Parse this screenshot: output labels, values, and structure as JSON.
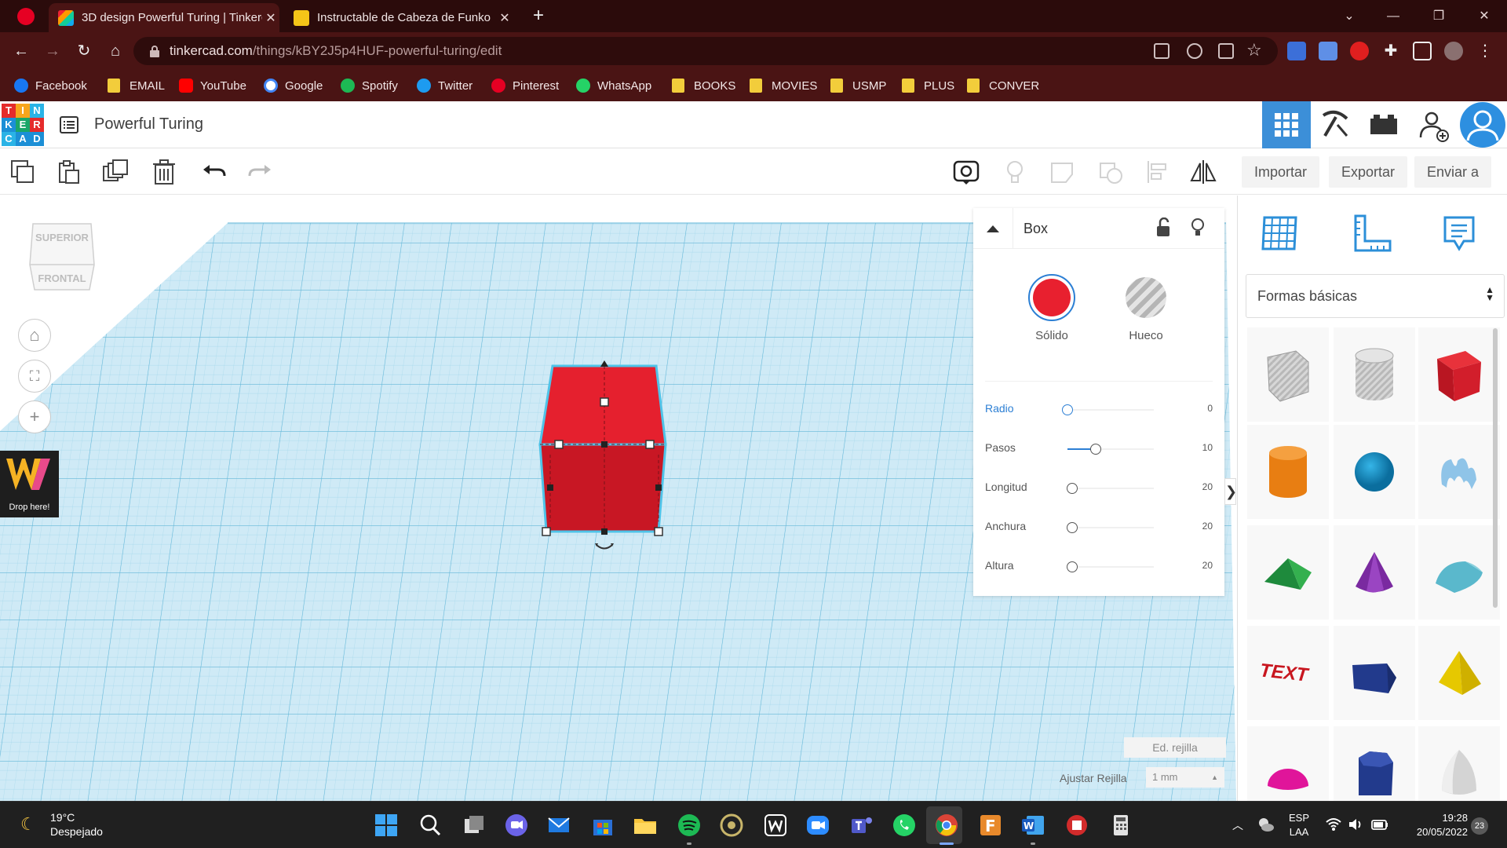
{
  "browser": {
    "tabs": [
      {
        "title": "3D design Powerful Turing | Tinkercad",
        "active": true
      },
      {
        "title": "Instructable de Cabeza de Funko",
        "active": false
      }
    ],
    "url_host": "tinkercad.com",
    "url_path": "/things/kBY2J5p4HUF-powerful-turing/edit",
    "bookmarks": [
      "Facebook",
      "EMAIL",
      "YouTube",
      "Google",
      "Spotify",
      "Twitter",
      "Pinterest",
      "WhatsApp",
      "BOOKS",
      "MOVIES",
      "USMP",
      "PLUS",
      "CONVER"
    ]
  },
  "app": {
    "logo_letters": [
      "T",
      "I",
      "N",
      "K",
      "E",
      "R",
      "C",
      "A",
      "D"
    ],
    "project_title": "Powerful Turing",
    "toolbar": {
      "import": "Importar",
      "export": "Exportar",
      "send_to": "Enviar a"
    }
  },
  "workplane": {
    "viewcube_top": "SUPERIOR",
    "viewcube_front": "FRONTAL",
    "drop_here": "Drop here!",
    "edit_grid": "Ed. rejilla",
    "snap_grid_label": "Ajustar Rejilla",
    "snap_grid_value": "1 mm"
  },
  "inspector": {
    "title": "Box",
    "solid_label": "Sólido",
    "hole_label": "Hueco",
    "solid_color": "#e8202f",
    "params": [
      {
        "label": "Radio",
        "value": "0",
        "fraction": 0.0
      },
      {
        "label": "Pasos",
        "value": "10",
        "fraction": 0.33
      },
      {
        "label": "Longitud",
        "value": "20",
        "fraction": 0.05
      },
      {
        "label": "Anchura",
        "value": "20",
        "fraction": 0.05
      },
      {
        "label": "Altura",
        "value": "20",
        "fraction": 0.05
      }
    ]
  },
  "shapes_panel": {
    "category": "Formas básicas",
    "shapes": [
      "box-hole",
      "cylinder-hole",
      "box",
      "cylinder",
      "sphere",
      "scribble",
      "roof",
      "cone",
      "round-roof",
      "text",
      "polygon-prism",
      "pyramid",
      "half-sphere",
      "hexagonal-prism",
      "paraboloid"
    ]
  },
  "taskbar": {
    "temperature": "19°C",
    "condition": "Despejado",
    "lang1": "ESP",
    "lang2": "LAA",
    "time": "19:28",
    "date": "20/05/2022",
    "notifications": "23"
  }
}
